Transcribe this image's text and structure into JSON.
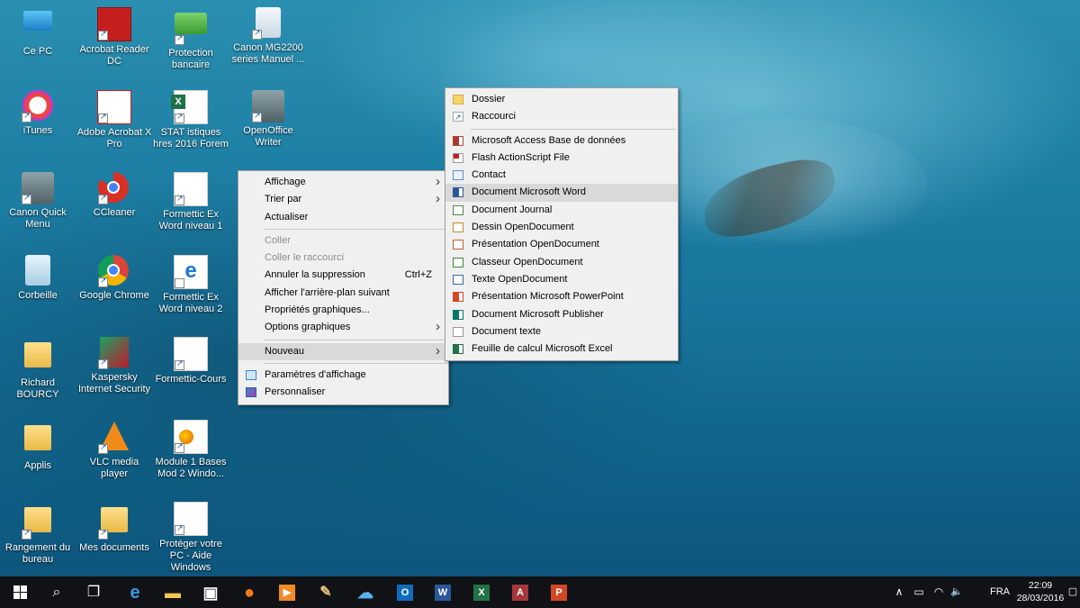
{
  "desktop": {
    "icons": [
      {
        "label": "Ce PC"
      },
      {
        "label": "Acrobat Reader DC"
      },
      {
        "label": "Protection bancaire"
      },
      {
        "label": "Canon MG2200 series Manuel ..."
      },
      {
        "label": "iTunes"
      },
      {
        "label": "Adobe Acrobat X Pro"
      },
      {
        "label": "STAT istiques hres 2016 Forem"
      },
      {
        "label": "OpenOffice Writer"
      },
      {
        "label": "Canon Quick Menu"
      },
      {
        "label": "CCleaner"
      },
      {
        "label": "Formettic Ex Word niveau 1"
      },
      {
        "label": "Corbeille"
      },
      {
        "label": "Google Chrome"
      },
      {
        "label": "Formettic Ex Word niveau 2"
      },
      {
        "label": "Richard BOURCY"
      },
      {
        "label": "Kaspersky Internet Security"
      },
      {
        "label": "Formettic-Cours"
      },
      {
        "label": "Applis"
      },
      {
        "label": "VLC media player"
      },
      {
        "label": "Module 1 Bases Mod 2 Windo..."
      },
      {
        "label": "Rangement du bureau"
      },
      {
        "label": "Mes documents"
      },
      {
        "label": "Protéger votre PC - Aide Windows"
      }
    ]
  },
  "context_menu": {
    "items": [
      {
        "label": "Affichage"
      },
      {
        "label": "Trier par"
      },
      {
        "label": "Actualiser"
      },
      {
        "label": "Coller"
      },
      {
        "label": "Coller le raccourci"
      },
      {
        "label": "Annuler la suppression",
        "shortcut": "Ctrl+Z"
      },
      {
        "label": "Afficher l'arrière-plan suivant"
      },
      {
        "label": "Propriétés graphiques..."
      },
      {
        "label": "Options graphiques"
      },
      {
        "label": "Nouveau"
      },
      {
        "label": "Paramètres d'affichage"
      },
      {
        "label": "Personnaliser"
      }
    ]
  },
  "submenu_nouveau": {
    "items": [
      {
        "label": "Dossier"
      },
      {
        "label": "Raccourci"
      },
      {
        "label": "Microsoft Access Base de données"
      },
      {
        "label": "Flash ActionScript File"
      },
      {
        "label": "Contact"
      },
      {
        "label": "Document Microsoft Word"
      },
      {
        "label": "Document Journal"
      },
      {
        "label": "Dessin OpenDocument"
      },
      {
        "label": "Présentation OpenDocument"
      },
      {
        "label": "Classeur OpenDocument"
      },
      {
        "label": "Texte OpenDocument"
      },
      {
        "label": "Présentation Microsoft PowerPoint"
      },
      {
        "label": "Document Microsoft Publisher"
      },
      {
        "label": "Document texte"
      },
      {
        "label": "Feuille de calcul Microsoft Excel"
      }
    ]
  },
  "taskbar": {
    "pinned": [
      {
        "icon": "start-icon"
      },
      {
        "icon": "search-icon",
        "glyph": "⌕"
      },
      {
        "icon": "task-view-icon",
        "glyph": "❐"
      },
      {
        "icon": "edge-icon",
        "glyph": "e"
      },
      {
        "icon": "file-explorer-icon",
        "glyph": "▬"
      },
      {
        "icon": "store-icon",
        "glyph": "▣"
      },
      {
        "icon": "firefox-icon",
        "glyph": "●"
      },
      {
        "icon": "media-player-icon",
        "glyph": "▶"
      },
      {
        "icon": "paint-icon",
        "glyph": "✎"
      },
      {
        "icon": "cloud-app-icon",
        "glyph": "☁"
      },
      {
        "icon": "outlook-icon",
        "glyph": "O"
      },
      {
        "icon": "word-icon",
        "glyph": "W"
      },
      {
        "icon": "excel-icon",
        "glyph": "X"
      },
      {
        "icon": "access-icon",
        "glyph": "A"
      },
      {
        "icon": "powerpoint-icon",
        "glyph": "P"
      }
    ],
    "tray": {
      "chevron_glyph": "∧",
      "battery_glyph": "▭",
      "network_glyph": "◠",
      "volume_glyph": "🔈",
      "language": "FRA",
      "time": "22:09",
      "date": "28/03/2016",
      "notification_glyph": "▢"
    },
    "colors": {
      "background": "#101215",
      "active_indicator": "#7aa7d6"
    }
  },
  "colors": {
    "menu_background": "#f0f0f0",
    "menu_highlight": "#d9d9d9",
    "disabled_text": "#8d8d8d"
  }
}
